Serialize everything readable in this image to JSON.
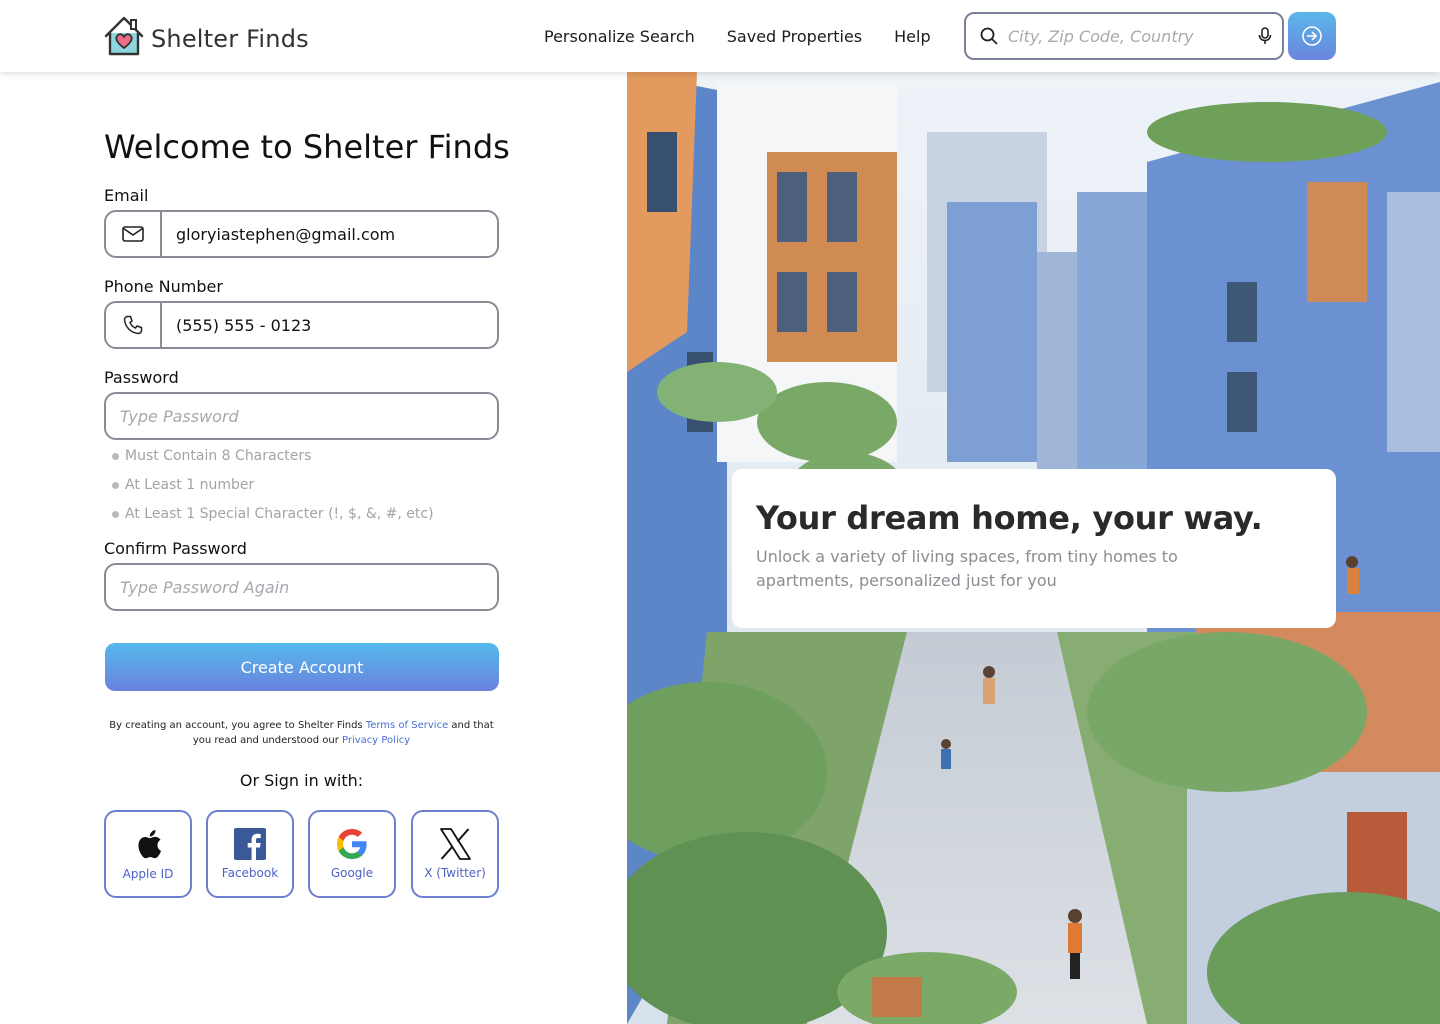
{
  "brand": {
    "name": "Shelter Finds"
  },
  "nav": {
    "items": [
      {
        "label": "Personalize Search"
      },
      {
        "label": "Saved Properties"
      },
      {
        "label": "Help"
      }
    ]
  },
  "search": {
    "placeholder": "City, Zip Code, Country",
    "value": ""
  },
  "form": {
    "title": "Welcome to Shelter Finds",
    "email": {
      "label": "Email",
      "value": "gloryiastephen@gmail.com"
    },
    "phone": {
      "label": "Phone Number",
      "value": "(555) 555 - 0123"
    },
    "password": {
      "label": "Password",
      "placeholder": "Type Password",
      "rules": [
        "Must Contain 8 Characters",
        "At Least 1 number",
        "At Least 1 Special Character (!, $, &, #,  etc)"
      ]
    },
    "confirm": {
      "label": "Confirm Password",
      "placeholder": "Type Password Again"
    },
    "submit_label": "Create Account",
    "terms": {
      "prefix": "By creating an account, you agree to Shelter Finds ",
      "tos": "Terms of Service",
      "middle": " and that you read and understood our ",
      "privacy": "Privacy Policy"
    },
    "or_sign_in": "Or Sign in with:",
    "social": [
      {
        "label": "Apple ID"
      },
      {
        "label": "Facebook"
      },
      {
        "label": "Google"
      },
      {
        "label": "X (Twitter)"
      }
    ]
  },
  "hero": {
    "title": "Your dream home, your way.",
    "subtitle": "Unlock a variety of living spaces, from tiny homes to apartments, personalized just for you"
  },
  "colors": {
    "accent_blue": "#5ab7ea",
    "accent_indigo": "#6a82de",
    "link": "#4a6fd1"
  },
  "icons": {
    "logo": "house-heart-icon",
    "search": "search-icon",
    "mic": "microphone-icon",
    "go": "arrow-right-circle-icon",
    "email": "envelope-icon",
    "phone": "phone-icon"
  }
}
